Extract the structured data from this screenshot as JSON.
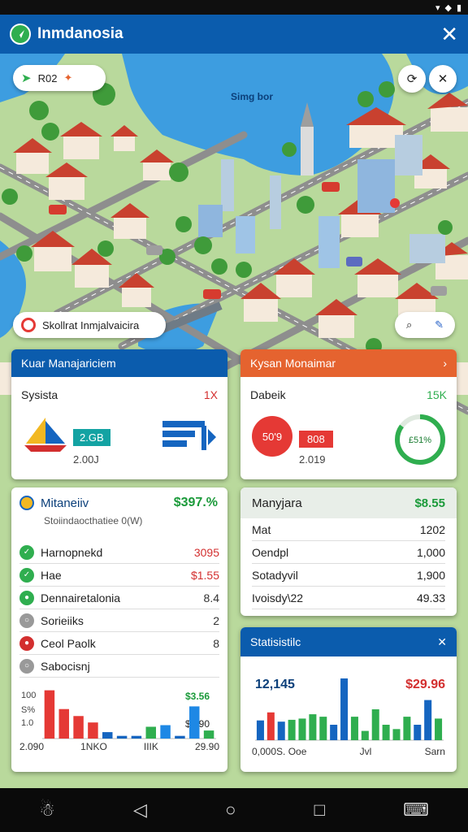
{
  "app": {
    "title": "Inmdanosia"
  },
  "map_controls": {
    "top_left_pill": "R02",
    "search_pill_label": "Skollrat Inmjalvaicira",
    "map_label": "Simg bor"
  },
  "card1": {
    "header": "Kuar Manajariciem",
    "label": "Sysista",
    "value": "1X",
    "badge": "2.GB",
    "sub": "2.00J"
  },
  "card2": {
    "header": "Kysan Monaimar",
    "label": "Dabeik",
    "value": "15K",
    "badge_left": "50'9",
    "badge_right": "808",
    "sub": "2.019",
    "ring_label": "£51%",
    "ring_fraction": 0.85
  },
  "card3": {
    "title": "Mitaneiiv",
    "title_value": "$397.%",
    "subtitle": "Stoiindaocthatiee 0(W)",
    "rows": [
      {
        "label": "Harnopnekd",
        "value": "3095",
        "color": "#d32f2f",
        "icon_color": "#2fae4f",
        "icon": "✓"
      },
      {
        "label": "Hae",
        "value": "$1.55",
        "color": "#d32f2f",
        "icon_color": "#2fae4f",
        "icon": "✓"
      },
      {
        "label": "Dennairetalonia",
        "value": "8.4",
        "color": "#333",
        "icon_color": "#2fae4f",
        "icon": "●"
      },
      {
        "label": "Sorieiiks",
        "value": "2",
        "color": "#333",
        "icon_color": "#999",
        "icon": "○"
      },
      {
        "label": "Ceol Paolk",
        "value": "8",
        "color": "#333",
        "icon_color": "#d32f2f",
        "icon": "●"
      },
      {
        "label": "Sabocisnj",
        "value": "",
        "color": "#333",
        "icon_color": "#999",
        "icon": "○"
      }
    ],
    "chart_left_ticks": [
      "100",
      "S%",
      "1.0"
    ],
    "chart_annot_top": "$3.56",
    "chart_annot_mid": "$4.90",
    "x_labels": [
      "2.090",
      "1NKO",
      "IIIK",
      "29.90"
    ]
  },
  "card4": {
    "header": "Manyjara",
    "header_value": "$8.55",
    "rows": [
      {
        "label": "Mat",
        "value": "1202"
      },
      {
        "label": "Oendpl",
        "value": "1,000"
      },
      {
        "label": "Sotadyvil",
        "value": "1,900"
      },
      {
        "label": "Ivoisdy\\22",
        "value": "49.33"
      }
    ]
  },
  "card5": {
    "header": "Statisistilc",
    "left_value": "12,145",
    "right_value": "$29.96",
    "x_labels": [
      "0,000S. Ooe",
      "Jvl",
      "Sarn"
    ]
  },
  "chart_data": [
    {
      "type": "bar",
      "title": "",
      "categories": [
        "1",
        "2",
        "3",
        "4",
        "5",
        "6",
        "7",
        "8",
        "9",
        "10",
        "11",
        "12"
      ],
      "series": [
        {
          "values": [
            0.9,
            0.55,
            0.42,
            0.3,
            0.12,
            0.05,
            0.05,
            0.22,
            0.25,
            0.05,
            0.6,
            0.15
          ]
        }
      ],
      "colors": [
        "#e53935",
        "#e53935",
        "#e53935",
        "#e53935",
        "#1565c0",
        "#1565c0",
        "#1565c0",
        "#2fae4f",
        "#1e88e5",
        "#1565c0",
        "#1e88e5",
        "#2fae4f"
      ],
      "ylim": [
        0,
        1
      ]
    },
    {
      "type": "bar",
      "title": "",
      "categories": [
        "1",
        "2",
        "3",
        "4",
        "5",
        "6",
        "7",
        "8",
        "9",
        "10",
        "11",
        "12",
        "13",
        "14",
        "15",
        "16",
        "17",
        "18"
      ],
      "series": [
        {
          "values": [
            0.32,
            0.45,
            0.3,
            0.33,
            0.35,
            0.42,
            0.38,
            0.25,
            1.0,
            0.38,
            0.15,
            0.5,
            0.25,
            0.18,
            0.38,
            0.25,
            0.65,
            0.35
          ]
        }
      ],
      "colors": [
        "#1565c0",
        "#e53935",
        "#1565c0",
        "#2fae4f",
        "#2fae4f",
        "#2fae4f",
        "#2fae4f",
        "#1565c0",
        "#1565c0",
        "#2fae4f",
        "#2fae4f",
        "#2fae4f",
        "#2fae4f",
        "#2fae4f",
        "#2fae4f",
        "#1565c0",
        "#1565c0",
        "#2fae4f"
      ],
      "ylim": [
        0,
        1
      ]
    }
  ]
}
